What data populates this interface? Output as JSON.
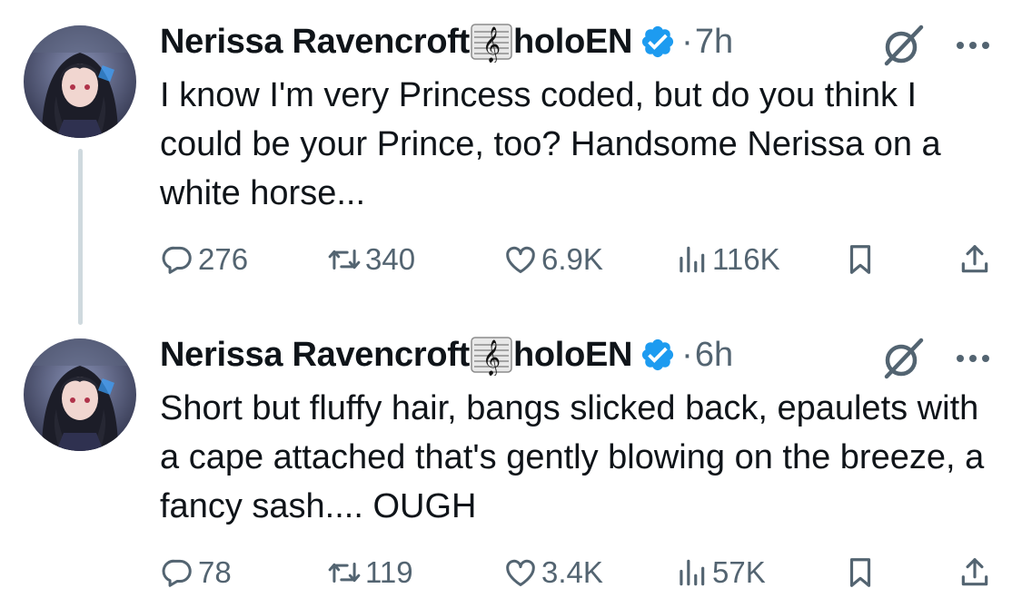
{
  "tweets": [
    {
      "author_name": "Nerissa Ravencroft",
      "handle_suffix": "holoEN",
      "time": "7h",
      "text": "I know I'm very Princess coded, but do you think I could be your Prince, too? Handsome Nerissa on a white horse...",
      "replies": "276",
      "reposts": "340",
      "likes": "6.9K",
      "views": "116K"
    },
    {
      "author_name": "Nerissa Ravencroft",
      "handle_suffix": "holoEN",
      "time": "6h",
      "text": "Short but fluffy hair, bangs slicked back, epaulets with a cape attached that's gently blowing on the breeze, a fancy sash.... OUGH",
      "replies": "78",
      "reposts": "119",
      "likes": "3.4K",
      "views": "57K"
    }
  ],
  "time_separator": "·",
  "icons": {
    "name_emoji": "music-score-icon",
    "verified": "verified-badge-icon",
    "grok": "grok-icon",
    "more": "more-icon",
    "reply": "reply-icon",
    "repost": "repost-icon",
    "like": "like-icon",
    "views": "views-icon",
    "bookmark": "bookmark-icon",
    "share": "share-icon"
  },
  "colors": {
    "text": "#0f1419",
    "secondary": "#536471",
    "verified": "#1d9bf0",
    "thread_line": "#cfd9de",
    "background": "#ffffff"
  }
}
